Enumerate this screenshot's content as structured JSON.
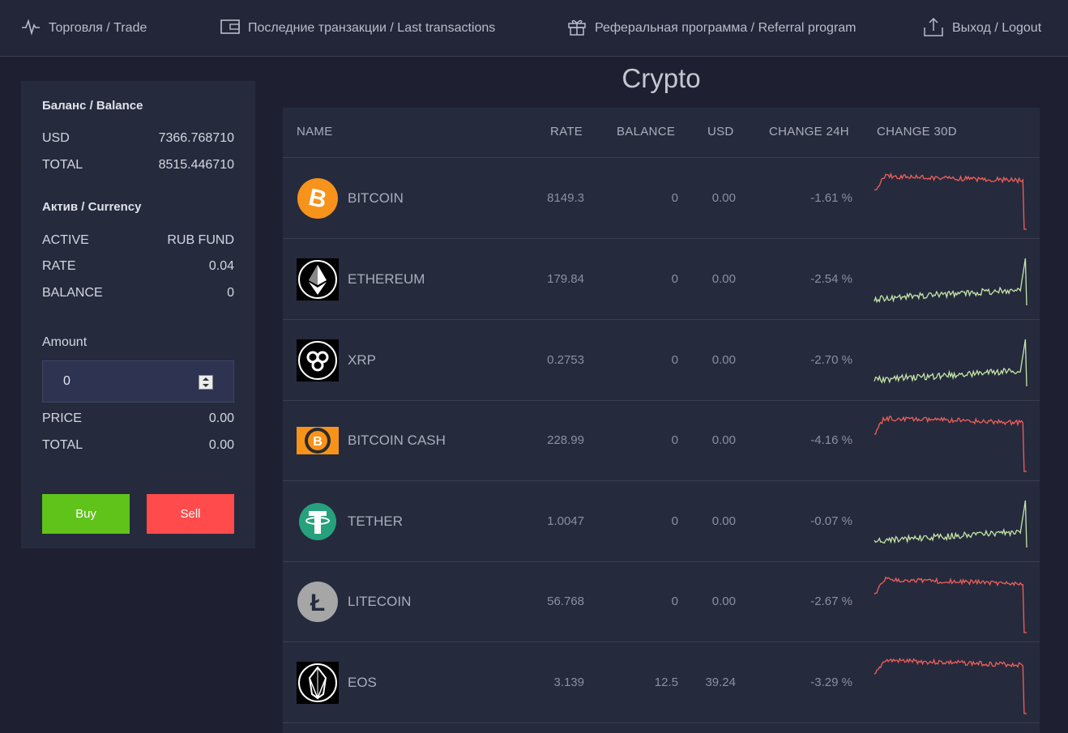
{
  "nav": {
    "trade": "Торговля / Trade",
    "transactions": "Последние транзакции / Last transactions",
    "referral": "Реферальная программа / Referral program",
    "logout": "Выход / Logout"
  },
  "sidebar": {
    "balance_title": "Баланс / Balance",
    "usd_label": "USD",
    "usd_value": "7366.768710",
    "total_label": "TOTAL",
    "total_value": "8515.446710",
    "currency_title": "Актив / Currency",
    "active_label": "ACTIVE",
    "active_value": "RUB FUND",
    "rate_label": "RATE",
    "rate_value": "0.04",
    "balance_label": "BALANCE",
    "balance_value": "0",
    "amount_label": "Amount",
    "amount_value": "0",
    "price_label": "PRICE",
    "price_value": "0.00",
    "total2_label": "TOTAL",
    "total2_value": "0.00",
    "buy_label": "Buy",
    "sell_label": "Sell"
  },
  "main": {
    "title": "Crypto",
    "headers": {
      "name": "NAME",
      "rate": "RATE",
      "balance": "BALANCE",
      "usd": "USD",
      "change24": "CHANGE 24H",
      "change30": "CHANGE 30D"
    },
    "rows": [
      {
        "name": "BITCOIN",
        "rate": "8149.3",
        "balance": "0",
        "usd": "0.00",
        "change24": "-1.61 %",
        "icon": "bitcoin-icon",
        "trend": "down"
      },
      {
        "name": "ETHEREUM",
        "rate": "179.84",
        "balance": "0",
        "usd": "0.00",
        "change24": "-2.54 %",
        "icon": "ethereum-icon",
        "trend": "up"
      },
      {
        "name": "XRP",
        "rate": "0.2753",
        "balance": "0",
        "usd": "0.00",
        "change24": "-2.70 %",
        "icon": "xrp-icon",
        "trend": "up"
      },
      {
        "name": "BITCOIN CASH",
        "rate": "228.99",
        "balance": "0",
        "usd": "0.00",
        "change24": "-4.16 %",
        "icon": "bitcoin-cash-icon",
        "trend": "down"
      },
      {
        "name": "TETHER",
        "rate": "1.0047",
        "balance": "0",
        "usd": "0.00",
        "change24": "-0.07 %",
        "icon": "tether-icon",
        "trend": "up"
      },
      {
        "name": "LITECOIN",
        "rate": "56.768",
        "balance": "0",
        "usd": "0.00",
        "change24": "-2.67 %",
        "icon": "litecoin-icon",
        "trend": "down"
      },
      {
        "name": "EOS",
        "rate": "3.139",
        "balance": "12.5",
        "usd": "39.24",
        "change24": "-3.29 %",
        "icon": "eos-icon",
        "trend": "down"
      }
    ]
  },
  "colors": {
    "buy": "#5fc31a",
    "sell": "#ff4b4b",
    "spark_down": "#f0605a",
    "spark_up": "#c5e6a6"
  }
}
